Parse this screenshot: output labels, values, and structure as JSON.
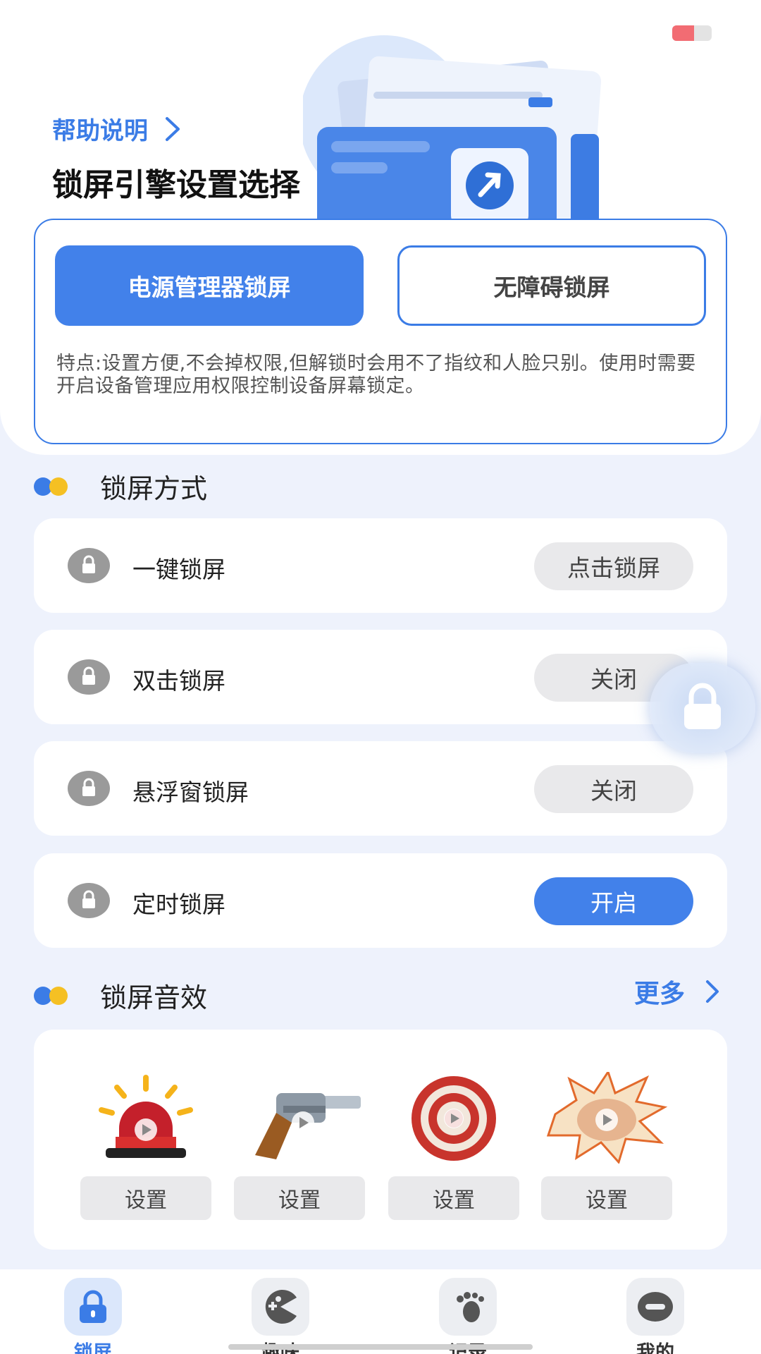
{
  "status_bar": {
    "battery_level": 0.55,
    "battery_color": "#f26c73"
  },
  "header": {
    "help_label": "帮助说明",
    "title": "锁屏引擎设置选择"
  },
  "engine": {
    "options": [
      "电源管理器锁屏",
      "无障碍锁屏"
    ],
    "selected_index": 0,
    "description": "特点:设置方便,不会掉权限,但解锁时会用不了指纹和人脸只别。使用时需要开启设备管理应用权限控制设备屏幕锁定。"
  },
  "lock_methods": {
    "title": "锁屏方式",
    "items": [
      {
        "label": "一键锁屏",
        "action": "点击锁屏",
        "state": "neutral"
      },
      {
        "label": "双击锁屏",
        "action": "关闭",
        "state": "off"
      },
      {
        "label": "悬浮窗锁屏",
        "action": "关闭",
        "state": "off"
      },
      {
        "label": "定时锁屏",
        "action": "开启",
        "state": "on"
      }
    ]
  },
  "sounds": {
    "title": "锁屏音效",
    "more_label": "更多",
    "items": [
      {
        "icon": "siren-icon",
        "button": "设置"
      },
      {
        "icon": "revolver-icon",
        "button": "设置"
      },
      {
        "icon": "target-icon",
        "button": "设置"
      },
      {
        "icon": "punch-icon",
        "button": "设置"
      }
    ]
  },
  "tabs": [
    {
      "label": "锁屏",
      "icon": "lock-icon",
      "active": true
    },
    {
      "label": "趣味",
      "icon": "pacman-icon",
      "active": false
    },
    {
      "label": "记录",
      "icon": "footprint-icon",
      "active": false
    },
    {
      "label": "我的",
      "icon": "profile-icon",
      "active": false
    }
  ],
  "colors": {
    "accent": "#3b7ce6",
    "accent_fill": "#4281ea",
    "secondary_dot": "#f5c023",
    "pill_gray": "#e9e9eb",
    "background": "#eef2fc"
  }
}
